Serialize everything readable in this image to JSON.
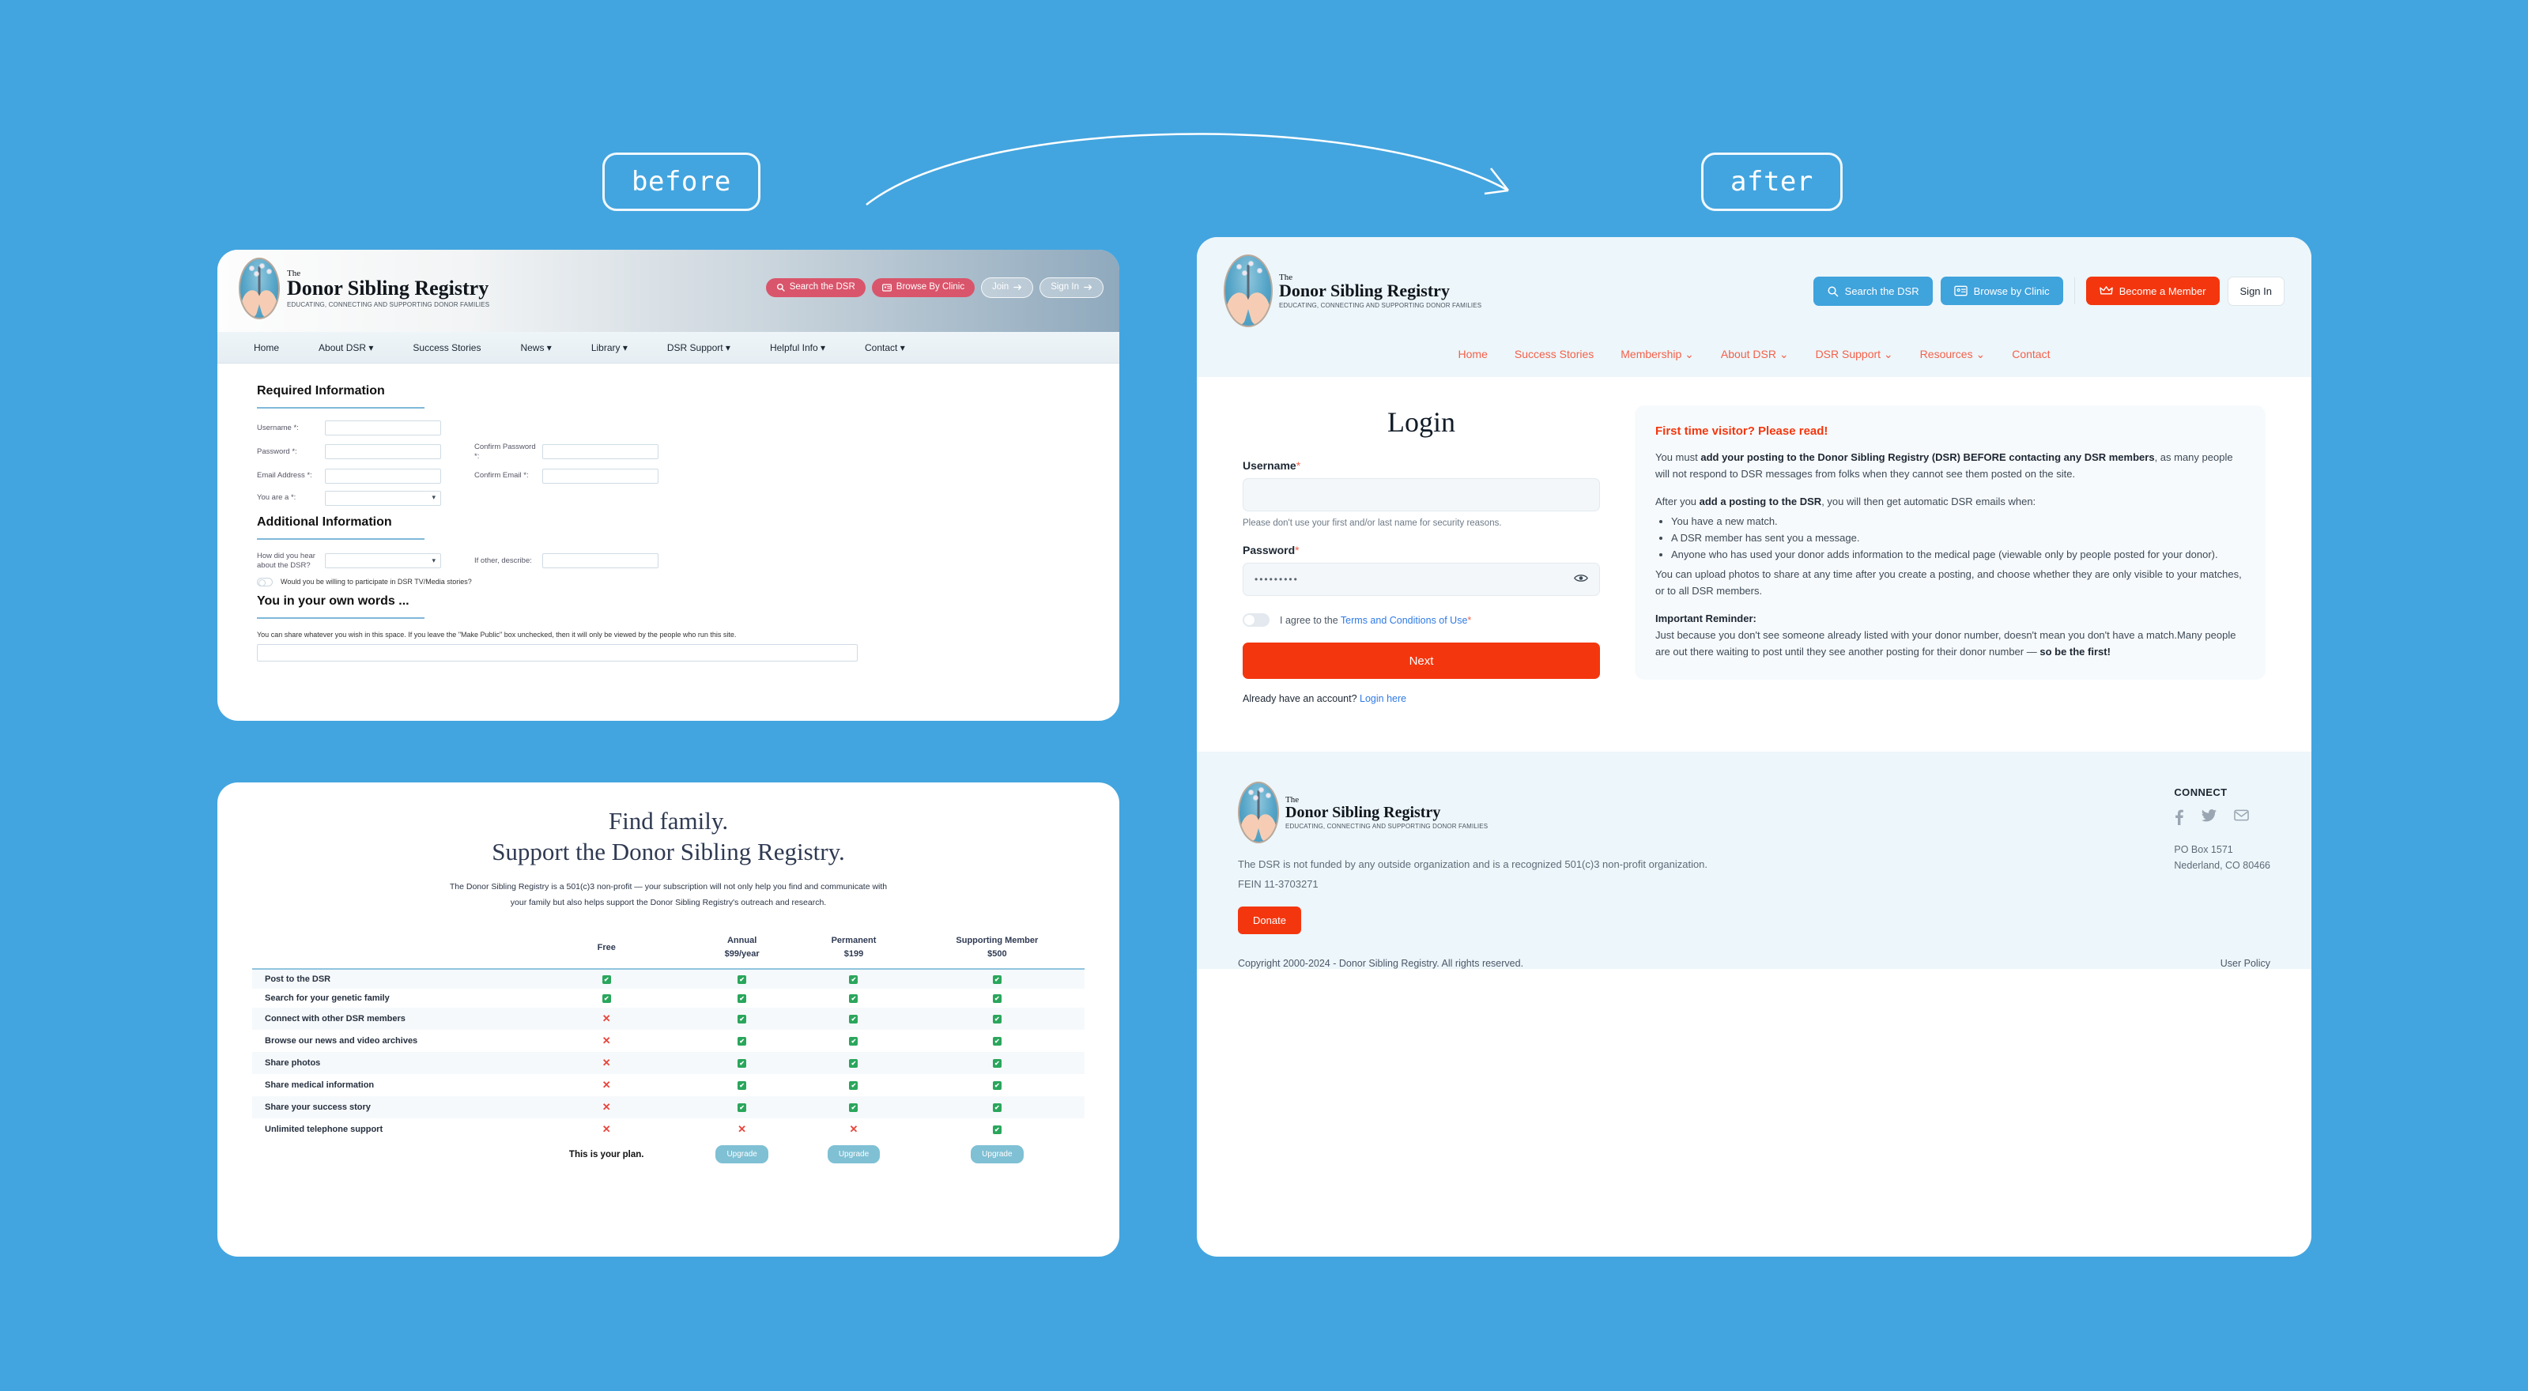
{
  "labels": {
    "before": "before",
    "after": "after"
  },
  "old_site": {
    "logo": {
      "pre": "The",
      "name": "Donor Sibling Registry",
      "tagline": "EDUCATING, CONNECTING AND SUPPORTING DONOR FAMILIES"
    },
    "actions": [
      {
        "label": "Search the DSR",
        "icon": "search-icon",
        "style": "rose"
      },
      {
        "label": "Browse By Clinic",
        "icon": "id-card-icon",
        "style": "rose"
      },
      {
        "label": "Join",
        "icon": "arrow-right-icon",
        "style": "ghost"
      },
      {
        "label": "Sign In",
        "icon": "arrow-right-icon",
        "style": "ghost"
      }
    ],
    "nav": [
      "Home",
      "About DSR ▾",
      "Success Stories",
      "News ▾",
      "Library ▾",
      "DSR Support ▾",
      "Helpful Info ▾",
      "Contact ▾"
    ],
    "form": {
      "section_required": "Required Information",
      "section_additional": "Additional Information",
      "section_words": "You in your own words ...",
      "username_label": "Username *:",
      "password_label": "Password *:",
      "confirm_password_label": "Confirm Password *:",
      "email_label": "Email Address *:",
      "confirm_email_label": "Confirm Email *:",
      "you_are_label": "You are a *:",
      "hear_about_label": "How did you hear about the DSR?",
      "if_other_label": "If other, describe:",
      "tv_media_label": "Would you be willing to participate in DSR TV/Media stories?",
      "words_note": "You can share whatever you wish in this space. If you leave the \"Make Public\" box unchecked, then it will only be viewed by the people who run this site."
    }
  },
  "pricing": {
    "headline_line1": "Find family.",
    "headline_line2": "Support the Donor Sibling Registry.",
    "subtext": "The Donor Sibling Registry is a 501(c)3 non-profit — your subscription will not only help you find and communicate with your family but also helps support the Donor Sibling Registry's outreach and research.",
    "columns": [
      {
        "name": "Free",
        "price": ""
      },
      {
        "name": "Annual",
        "price": "$99/year"
      },
      {
        "name": "Permanent",
        "price": "$199"
      },
      {
        "name": "Supporting Member",
        "price": "$500"
      }
    ],
    "rows": [
      {
        "feature": "Post to the DSR",
        "values": [
          "yes",
          "yes",
          "yes",
          "yes"
        ]
      },
      {
        "feature": "Search for your genetic family",
        "values": [
          "yes",
          "yes",
          "yes",
          "yes"
        ]
      },
      {
        "feature": "Connect with other DSR members",
        "values": [
          "no",
          "yes",
          "yes",
          "yes"
        ]
      },
      {
        "feature": "Browse our news and video archives",
        "values": [
          "no",
          "yes",
          "yes",
          "yes"
        ]
      },
      {
        "feature": "Share photos",
        "values": [
          "no",
          "yes",
          "yes",
          "yes"
        ]
      },
      {
        "feature": "Share medical information",
        "values": [
          "no",
          "yes",
          "yes",
          "yes"
        ]
      },
      {
        "feature": "Share your success story",
        "values": [
          "no",
          "yes",
          "yes",
          "yes"
        ]
      },
      {
        "feature": "Unlimited telephone support",
        "values": [
          "no",
          "no",
          "no",
          "yes"
        ]
      }
    ],
    "footer_row": {
      "current_plan": "This is your plan.",
      "upgrade_label": "Upgrade"
    }
  },
  "new_site": {
    "logo": {
      "pre": "The",
      "name": "Donor Sibling Registry",
      "tagline": "EDUCATING, CONNECTING AND SUPPORTING DONOR FAMILIES"
    },
    "actions": [
      {
        "label": "Search the DSR",
        "icon": "search-icon",
        "style": "blue"
      },
      {
        "label": "Browse by Clinic",
        "icon": "id-card-icon",
        "style": "blue"
      },
      {
        "label": "Become a Member",
        "icon": "crown-icon",
        "style": "red"
      },
      {
        "label": "Sign In",
        "icon": "",
        "style": "plain"
      }
    ],
    "nav": [
      "Home",
      "Success Stories",
      "Membership ⌄",
      "About DSR ⌄",
      "DSR Support ⌄",
      "Resources ⌄",
      "Contact"
    ],
    "login": {
      "title": "Login",
      "username_label": "Username",
      "username_value": "",
      "username_hint": "Please don't use your first and/or last name for security reasons.",
      "password_label": "Password",
      "password_value": "•••••••••",
      "show_password_icon": "eye-icon",
      "agree_prefix": "I agree to the ",
      "agree_link": "Terms and Conditions of Use",
      "next_label": "Next",
      "already_prefix": "Already have an account? ",
      "already_link": "Login here",
      "required_mark": "*"
    },
    "info": {
      "heading": "First time visitor? Please read!",
      "p1_a": "You must ",
      "p1_b": "add your posting to the Donor Sibling Registry (DSR) BEFORE contacting any DSR members",
      "p1_c": ", as many people will not respond to DSR messages from folks when they cannot see them posted on the site.",
      "p2_a": "After you ",
      "p2_b": "add a posting to the DSR",
      "p2_c": ", you will then get automatic DSR emails when:",
      "bullets": [
        "You have a new match.",
        "A DSR member has sent you a message.",
        "Anyone who has used your donor adds information to the medical page (viewable only by people posted for your donor)."
      ],
      "p3": "You can upload photos to share at any time after you create a posting, and choose whether they are only visible to your matches, or to all DSR members.",
      "reminder_heading": "Important Reminder:",
      "reminder_a": "Just because you don't see someone already listed with your donor number, doesn't mean you don't have a match.Many people are out there waiting to post until they see another posting for their donor number — ",
      "reminder_b": "so be the first!"
    },
    "footer": {
      "description": "The DSR is not funded by any outside organization and is a recognized 501(c)3 non-profit organization.",
      "fein": "FEIN 11-3703271",
      "donate_label": "Donate",
      "connect_heading": "CONNECT",
      "socials": [
        "facebook-icon",
        "twitter-icon",
        "email-icon"
      ],
      "address_line1": "PO Box 1571",
      "address_line2": "Nederland, CO 80466",
      "copyright": "Copyright 2000-2024 - Donor Sibling Registry. All rights reserved.",
      "user_policy": "User Policy"
    }
  },
  "colors": {
    "page_background": "#43a5df",
    "old_accent": "#d9556b",
    "new_blue": "#3fa3dc",
    "new_red": "#f4360e",
    "nav_orange": "#f4604a",
    "check_green": "#2aa65c",
    "cross_red": "#e8453c"
  }
}
